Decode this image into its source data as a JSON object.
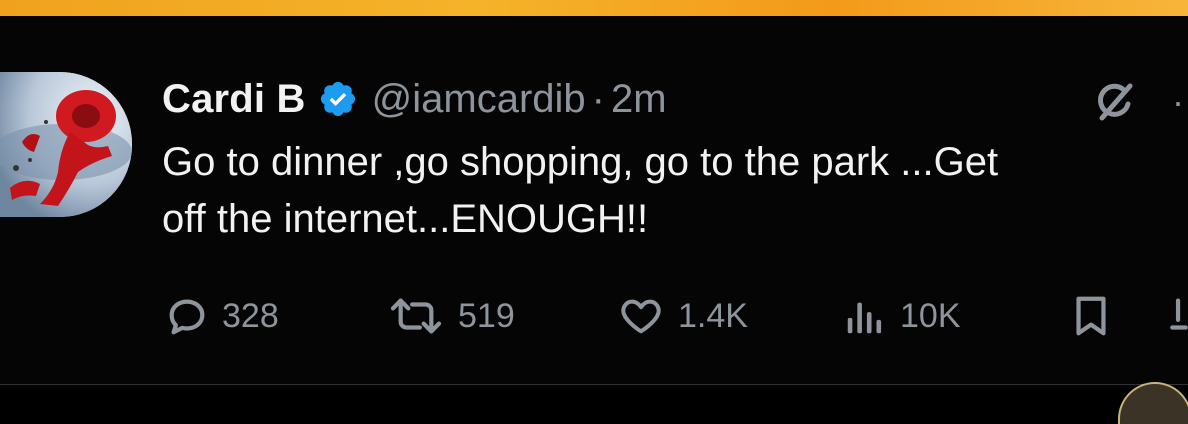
{
  "tweet": {
    "display_name": "Cardi B",
    "handle": "@iamcardib",
    "separator": "·",
    "time": "2m",
    "text": "Go to dinner ,go shopping, go to the park ...Get\noff the internet...ENOUGH!!",
    "verified_color": "#1d9bf0"
  },
  "actions": {
    "replies": "328",
    "reposts": "519",
    "likes": "1.4K",
    "views": "10K"
  },
  "icons": {
    "reply": "reply-icon",
    "repost": "repost-icon",
    "like": "heart-icon",
    "views": "views-icon",
    "bookmark": "bookmark-icon",
    "grok": "grok-icon",
    "more": "more-icon",
    "share": "share-icon"
  }
}
